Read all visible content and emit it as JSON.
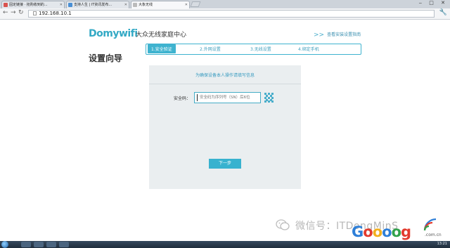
{
  "browser": {
    "tabs": [
      {
        "label": "固定链接 · 抢购收到的..."
      },
      {
        "label": "支持人生 | IT资讯发布..."
      },
      {
        "label": "大象无线"
      }
    ],
    "address": "192.168.10.1",
    "window_controls": "‒ □ ✕"
  },
  "page": {
    "brand": "Domywifi",
    "brand_sub": "大众无线家庭中心",
    "help_link": "查看安装设置指南",
    "wizard_title": "设置向导",
    "steps": [
      {
        "label": "1.安全验证",
        "active": true
      },
      {
        "label": "2.外网设置",
        "active": false
      },
      {
        "label": "3.无线设置",
        "active": false
      },
      {
        "label": "4.绑定手机",
        "active": false
      }
    ],
    "panel_heading": "为确保设备本人操作请填写信息",
    "security_label": "安全码：",
    "security_placeholder": "安全码为序列号（SN）后6位",
    "next_button": "下一步"
  },
  "watermark": {
    "wechat_text": "微信号：ITDongMinS",
    "logo_letters": [
      "G",
      "o",
      "o",
      "o",
      "o",
      "g"
    ],
    "domain": ".com.cn"
  },
  "taskbar": {
    "clock": "13:21"
  },
  "colors": {
    "accent": "#38b2cf",
    "panel": "#eaeef0",
    "brand": "#33a9c5"
  }
}
